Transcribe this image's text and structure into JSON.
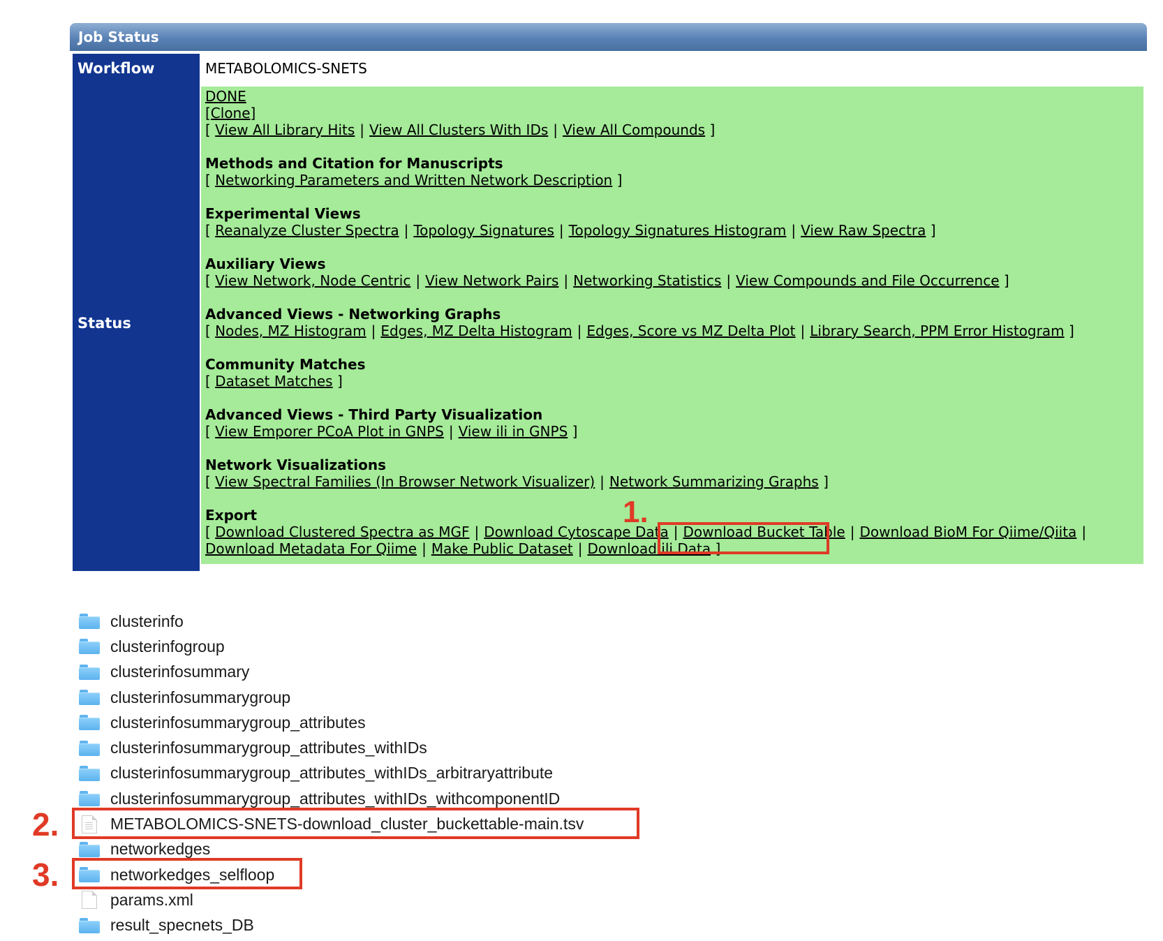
{
  "panel": {
    "header": "Job Status",
    "workflow_label": "Workflow",
    "workflow_value": "METABOLOMICS-SNETS",
    "status_label": "Status"
  },
  "status": {
    "done": "DONE",
    "clone": "[Clone]",
    "open": "[",
    "close": "]",
    "sep": "|",
    "top_links": [
      "View All Library Hits",
      "View All Clusters With IDs",
      "View All Compounds"
    ],
    "sections": [
      {
        "title": "Methods and Citation for Manuscripts",
        "links": [
          "Networking Parameters and Written Network Description"
        ]
      },
      {
        "title": "Experimental Views",
        "links": [
          "Reanalyze Cluster Spectra",
          "Topology Signatures",
          "Topology Signatures Histogram",
          "View Raw Spectra"
        ]
      },
      {
        "title": "Auxiliary Views",
        "links": [
          "View Network, Node Centric",
          "View Network Pairs",
          "Networking Statistics",
          "View Compounds and File Occurrence"
        ]
      },
      {
        "title": "Advanced Views - Networking Graphs",
        "links": [
          "Nodes, MZ Histogram",
          "Edges, MZ Delta Histogram",
          "Edges, Score vs MZ Delta Plot",
          "Library Search, PPM Error Histogram"
        ]
      },
      {
        "title": "Community Matches",
        "links": [
          "Dataset Matches"
        ]
      },
      {
        "title": "Advanced Views - Third Party Visualization",
        "links": [
          "View Emporer PCoA Plot in GNPS",
          "View ili in GNPS"
        ]
      },
      {
        "title": "Network Visualizations",
        "links": [
          "View Spectral Families (In Browser Network Visualizer)",
          "Network Summarizing Graphs"
        ]
      }
    ],
    "export": {
      "title": "Export",
      "links": [
        "Download Clustered Spectra as MGF",
        "Download Cytoscape Data",
        "Download Bucket Table",
        "Download BioM For Qiime/Qiita",
        "Download Metadata For Qiime",
        "Make Public Dataset",
        "Download ili Data"
      ]
    }
  },
  "annotations": {
    "one": "1.",
    "two": "2.",
    "three": "3.",
    "color": "#e03a26"
  },
  "files": [
    {
      "name": "clusterinfo",
      "icon": "folder-icon"
    },
    {
      "name": "clusterinfogroup",
      "icon": "folder-icon"
    },
    {
      "name": "clusterinfosummary",
      "icon": "folder-icon"
    },
    {
      "name": "clusterinfosummarygroup",
      "icon": "folder-icon"
    },
    {
      "name": "clusterinfosummarygroup_attributes",
      "icon": "folder-icon"
    },
    {
      "name": "clusterinfosummarygroup_attributes_withIDs",
      "icon": "folder-icon"
    },
    {
      "name": "clusterinfosummarygroup_attributes_withIDs_arbitraryattribute",
      "icon": "folder-icon"
    },
    {
      "name": "clusterinfosummarygroup_attributes_withIDs_withcomponentID",
      "icon": "folder-icon"
    },
    {
      "name": "METABOLOMICS-SNETS-download_cluster_buckettable-main.tsv",
      "icon": "text-file-icon"
    },
    {
      "name": "networkedges",
      "icon": "folder-icon"
    },
    {
      "name": "networkedges_selfloop",
      "icon": "folder-icon"
    },
    {
      "name": "params.xml",
      "icon": "file-icon"
    },
    {
      "name": "result_specnets_DB",
      "icon": "folder-icon"
    }
  ],
  "colors": {
    "header_blue": "#5a82b6",
    "label_blue": "#123590",
    "status_green": "#a5eb99"
  }
}
